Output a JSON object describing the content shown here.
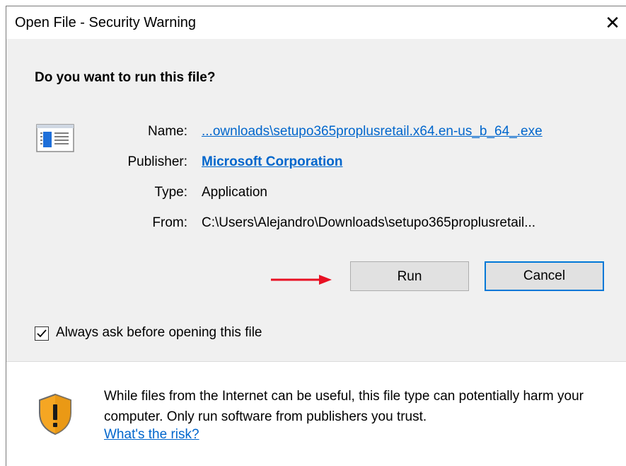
{
  "window": {
    "title": "Open File - Security Warning",
    "close_glyph": "✕"
  },
  "prompt": {
    "question": "Do you want to run this file?"
  },
  "file_info": {
    "name_label": "Name:",
    "name_value": "...ownloads\\setupo365proplusretail.x64.en-us_b_64_.exe",
    "publisher_label": "Publisher:",
    "publisher_value": "Microsoft Corporation",
    "type_label": "Type:",
    "type_value": "Application",
    "from_label": "From:",
    "from_value": "C:\\Users\\Alejandro\\Downloads\\setupo365proplusretail..."
  },
  "buttons": {
    "run_label": "Run",
    "cancel_label": "Cancel"
  },
  "checkbox": {
    "label": "Always ask before opening this file",
    "checked": true
  },
  "warning": {
    "text": "While files from the Internet can be useful, this file type can potentially harm your computer. Only run software from publishers you trust.",
    "risk_link": "What's the risk?"
  },
  "colors": {
    "link": "#0066cc",
    "accent_border": "#0078d7",
    "arrow": "#e81123",
    "shield": "#f5a623"
  },
  "icons": {
    "file": "application-file-icon",
    "shield": "warning-shield-icon",
    "arrow": "red-arrow-pointer",
    "close": "close-icon",
    "check": "checkmark-icon"
  }
}
